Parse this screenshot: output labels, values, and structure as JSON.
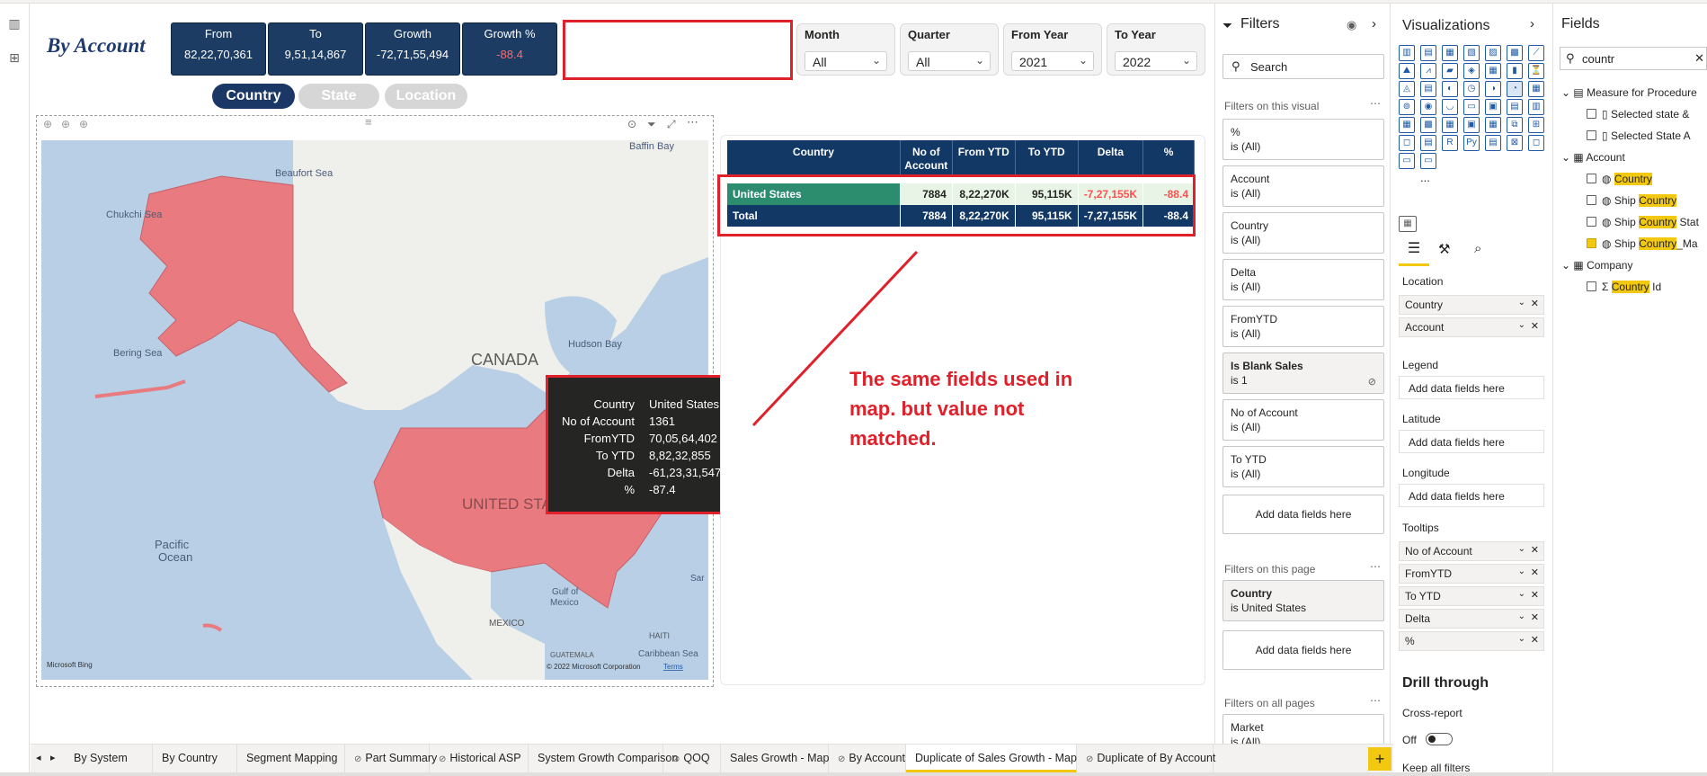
{
  "page": {
    "title": "By Account"
  },
  "kpis": [
    {
      "label": "From",
      "value": "82,22,70,361"
    },
    {
      "label": "To",
      "value": "9,51,14,867"
    },
    {
      "label": "Growth",
      "value": "-72,71,55,494"
    },
    {
      "label": "Growth %",
      "value": "-88.4"
    }
  ],
  "slicers": [
    {
      "label": "Month",
      "value": "All"
    },
    {
      "label": "Quarter",
      "value": "All"
    },
    {
      "label": "From Year",
      "value": "2021"
    },
    {
      "label": "To Year",
      "value": "2022"
    }
  ],
  "toggle": {
    "country": "Country",
    "state": "State",
    "location": "Location"
  },
  "map": {
    "labels": {
      "baffin": "Baffin Bay",
      "beaufort": "Beaufort Sea",
      "chukchi": "Chukchi Sea",
      "bering": "Bering Sea",
      "canada": "CANADA",
      "hudson": "Hudson Bay",
      "us": "UNITED STATES",
      "pacific1": "Pacific",
      "pacific2": "Ocean",
      "gulf1": "Gulf of",
      "gulf2": "Mexico",
      "mexico": "MEXICO",
      "haiti": "HAITI",
      "guatemala": "GUATEMALA",
      "caribbean": "Caribbean Sea",
      "sar": "Sar"
    },
    "logo": "Microsoft Bing",
    "copyright": "© 2022 Microsoft Corporation",
    "terms": "Terms",
    "colors": {
      "water": "#b8cfe6",
      "land": "#efefec",
      "highlight": "#e87a80"
    }
  },
  "tooltip": [
    {
      "key": "Country",
      "value": "United States"
    },
    {
      "key": "No of Account",
      "value": "1361"
    },
    {
      "key": "FromYTD",
      "value": "70,05,64,402"
    },
    {
      "key": "To YTD",
      "value": "8,82,32,855"
    },
    {
      "key": "Delta",
      "value": "-61,23,31,547"
    },
    {
      "key": "%",
      "value": "-87.4"
    }
  ],
  "table": {
    "headers": {
      "country": "Country",
      "accounts_1": "No of",
      "accounts_2": "Account",
      "from": "From YTD",
      "to": "To YTD",
      "delta": "Delta",
      "pct": "%"
    },
    "rows": [
      {
        "country": "United States",
        "accounts": "7884",
        "from": "8,22,270K",
        "to": "95,115K",
        "delta": "-7,27,155K",
        "pct": "-88.4"
      },
      {
        "country": "Total",
        "accounts": "7884",
        "from": "8,22,270K",
        "to": "95,115K",
        "delta": "-7,27,155K",
        "pct": "-88.4"
      }
    ]
  },
  "annotation": {
    "line1": "The same fields used in",
    "line2": "map. but value not",
    "line3": "matched."
  },
  "filters": {
    "title": "Filters",
    "search_placeholder": "Search",
    "on_visual_label": "Filters on this visual",
    "on_visual": [
      {
        "name": "%",
        "state": "is (All)"
      },
      {
        "name": "Account",
        "state": "is (All)"
      },
      {
        "name": "Country",
        "state": "is (All)"
      },
      {
        "name": "Delta",
        "state": "is (All)"
      },
      {
        "name": "FromYTD",
        "state": "is (All)"
      },
      {
        "name": "Is Blank Sales",
        "state": "is 1"
      },
      {
        "name": "No of Account",
        "state": "is (All)"
      },
      {
        "name": "To YTD",
        "state": "is (All)"
      }
    ],
    "add_fields": "Add data fields here",
    "on_page_label": "Filters on this page",
    "on_page": [
      {
        "name": "Country",
        "state": "is United States"
      }
    ],
    "on_all_label": "Filters on all pages",
    "on_all": [
      {
        "name": "Market",
        "state": "is (All)"
      }
    ]
  },
  "visualizations": {
    "title": "Visualizations",
    "wells": {
      "location_label": "Location",
      "location_items": [
        "Country",
        "Account"
      ],
      "legend_label": "Legend",
      "latitude_label": "Latitude",
      "longitude_label": "Longitude",
      "tooltips_label": "Tooltips",
      "tooltips_items": [
        "No of Account",
        "FromYTD",
        "To YTD",
        "Delta",
        "%"
      ],
      "add_placeholder": "Add data fields here"
    },
    "drill": {
      "title": "Drill through",
      "cross_report": "Cross-report",
      "toggle_state": "Off",
      "keep_filters": "Keep all filters"
    },
    "icon_python": "Py",
    "icon_r": "R",
    "more": "..."
  },
  "fields": {
    "title": "Fields",
    "search_value": "countr",
    "tables": [
      {
        "name": "Measure for Procedure",
        "items": [
          "Selected state &",
          "Selected State A"
        ]
      },
      {
        "name": "Account",
        "items": [
          {
            "pre": "",
            "hl": "Country",
            "post": "",
            "checked": false
          },
          {
            "pre": "Ship ",
            "hl": "Country",
            "post": "",
            "checked": false
          },
          {
            "pre": "Ship ",
            "hl": "Country",
            "post": " Stat",
            "checked": false
          },
          {
            "pre": "Ship ",
            "hl": "Country",
            "post": "_Ma",
            "checked": true
          }
        ]
      },
      {
        "name": "Company",
        "items": [
          {
            "pre": "",
            "hl": "Country",
            "post": " Id",
            "checked": false
          }
        ]
      }
    ]
  },
  "tabs": [
    "By System",
    "By Country",
    "Segment Mapping",
    "Part Summary",
    "Historical ASP",
    "System Growth Comparison",
    "QOQ",
    "Sales Growth - Map",
    "By Account",
    "Duplicate of Sales Growth - Map",
    "Duplicate of By Account"
  ],
  "active_tab": "Duplicate of Sales Growth - Map"
}
